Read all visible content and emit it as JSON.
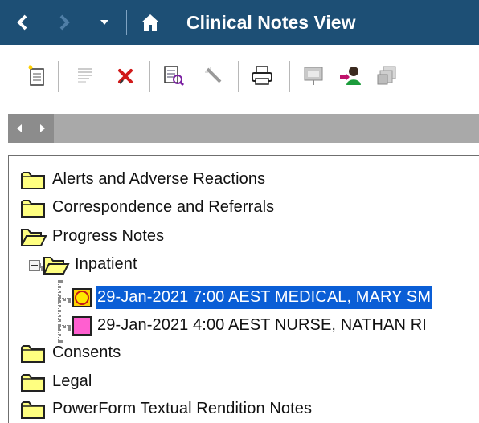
{
  "titlebar": {
    "title": "Clinical Notes View",
    "colors": {
      "background": "#1d4f75",
      "text": "#ffffff"
    },
    "icons": [
      "back-arrow-icon",
      "forward-arrow-icon",
      "dropdown-arrow-icon",
      "home-icon"
    ]
  },
  "toolbar": {
    "icons": [
      "new-note-icon",
      "cut-note-icon",
      "delete-icon",
      "review-icon",
      "wand-icon",
      "print-icon",
      "presentation-icon",
      "forward-user-icon",
      "copy-pages-icon"
    ]
  },
  "tree": {
    "items": [
      {
        "label": "Alerts and Adverse Reactions",
        "type": "folder",
        "open": false
      },
      {
        "label": "Correspondence and Referrals",
        "type": "folder",
        "open": false
      },
      {
        "label": "Progress Notes",
        "type": "folder",
        "open": true
      },
      {
        "label": "Inpatient",
        "type": "folder",
        "open": true
      },
      {
        "label": "29-Jan-2021 7:00 AEST MEDICAL, MARY SM",
        "type": "note",
        "icon_color": "#ffd400",
        "selected": true
      },
      {
        "label": "29-Jan-2021 4:00 AEST NURSE, NATHAN RI",
        "type": "note",
        "icon_color": "#ff5fd0",
        "selected": false
      },
      {
        "label": "Consents",
        "type": "folder",
        "open": false
      },
      {
        "label": "Legal",
        "type": "folder",
        "open": false
      },
      {
        "label": "PowerForm Textual Rendition Notes",
        "type": "folder",
        "open": false
      }
    ],
    "colors": {
      "selection": "#0a5ed6",
      "folder": "#ffff80"
    }
  }
}
